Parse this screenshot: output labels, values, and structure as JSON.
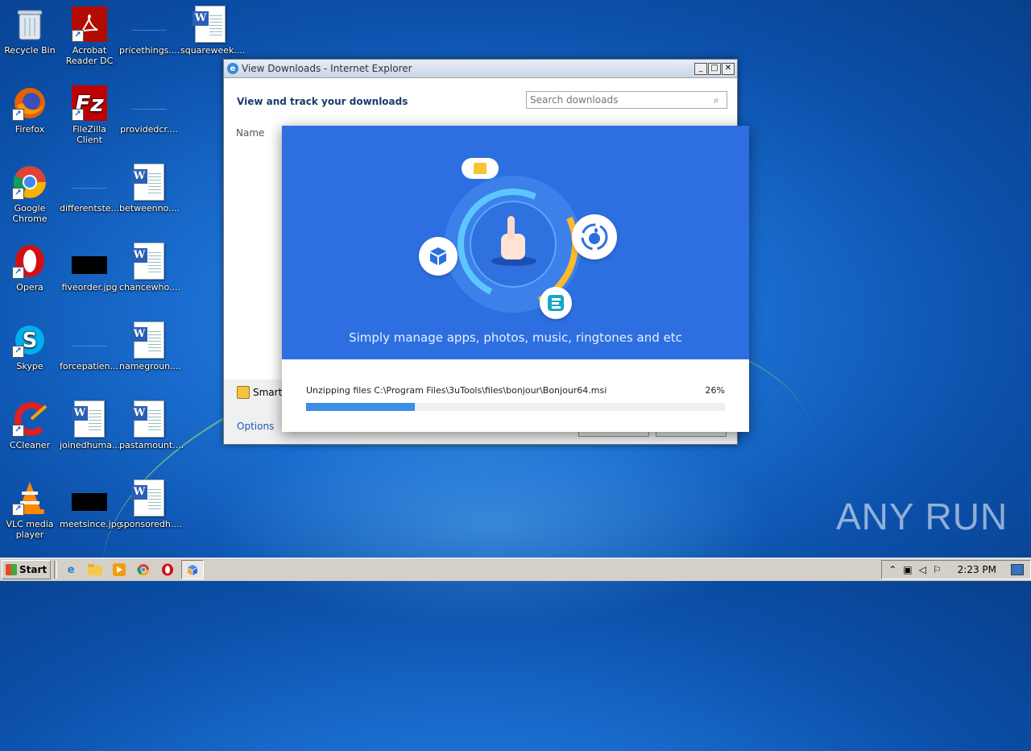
{
  "desktop": {
    "icons": [
      {
        "label": "Recycle Bin",
        "icon": "recycle-bin-icon"
      },
      {
        "label": "Acrobat Reader DC",
        "icon": "acrobat-icon"
      },
      {
        "label": "pricethings....",
        "icon": "blank-file-icon"
      },
      {
        "label": "squareweek....",
        "icon": "word-document-icon"
      },
      {
        "label": "Firefox",
        "icon": "firefox-icon"
      },
      {
        "label": "FileZilla Client",
        "icon": "filezilla-icon"
      },
      {
        "label": "providedcr....",
        "icon": "blank-file-icon"
      },
      {
        "label": "Google Chrome",
        "icon": "chrome-icon"
      },
      {
        "label": "differentste....",
        "icon": "blank-file-icon"
      },
      {
        "label": "betweenno....",
        "icon": "word-document-icon"
      },
      {
        "label": "Opera",
        "icon": "opera-icon"
      },
      {
        "label": "fiveorder.jpg",
        "icon": "image-file-icon"
      },
      {
        "label": "chancewho....",
        "icon": "word-document-icon"
      },
      {
        "label": "Skype",
        "icon": "skype-icon"
      },
      {
        "label": "forcepatien....",
        "icon": "blank-file-icon"
      },
      {
        "label": "namegroun....",
        "icon": "word-document-icon"
      },
      {
        "label": "CCleaner",
        "icon": "ccleaner-icon"
      },
      {
        "label": "joinedhuma....",
        "icon": "word-document-icon"
      },
      {
        "label": "pastamount....",
        "icon": "word-document-icon"
      },
      {
        "label": "VLC media player",
        "icon": "vlc-icon"
      },
      {
        "label": "meetsince.jpg",
        "icon": "image-file-icon"
      },
      {
        "label": "sponsoredh....",
        "icon": "word-document-icon"
      }
    ]
  },
  "ie_window": {
    "title": "View Downloads - Internet Explorer",
    "header_title": "View and track your downloads",
    "search_placeholder": "Search downloads",
    "column_name": "Name",
    "smartscreen_label": "SmartS",
    "options_label": "Options"
  },
  "installer": {
    "caption": "Simply manage apps, photos, music, ringtones and etc",
    "status_text": "Unzipping files  C:\\Program Files\\3uTools\\files\\bonjour\\Bonjour64.msi",
    "percent_text": "26%",
    "progress_fraction": 0.26
  },
  "watermark": "ANY RUN",
  "taskbar": {
    "start_label": "Start",
    "clock": "2:23 PM"
  },
  "colors": {
    "installer_blue": "#2d6fe0",
    "progress_blue": "#3d8ee6",
    "accent_yellow": "#ffb92b"
  }
}
